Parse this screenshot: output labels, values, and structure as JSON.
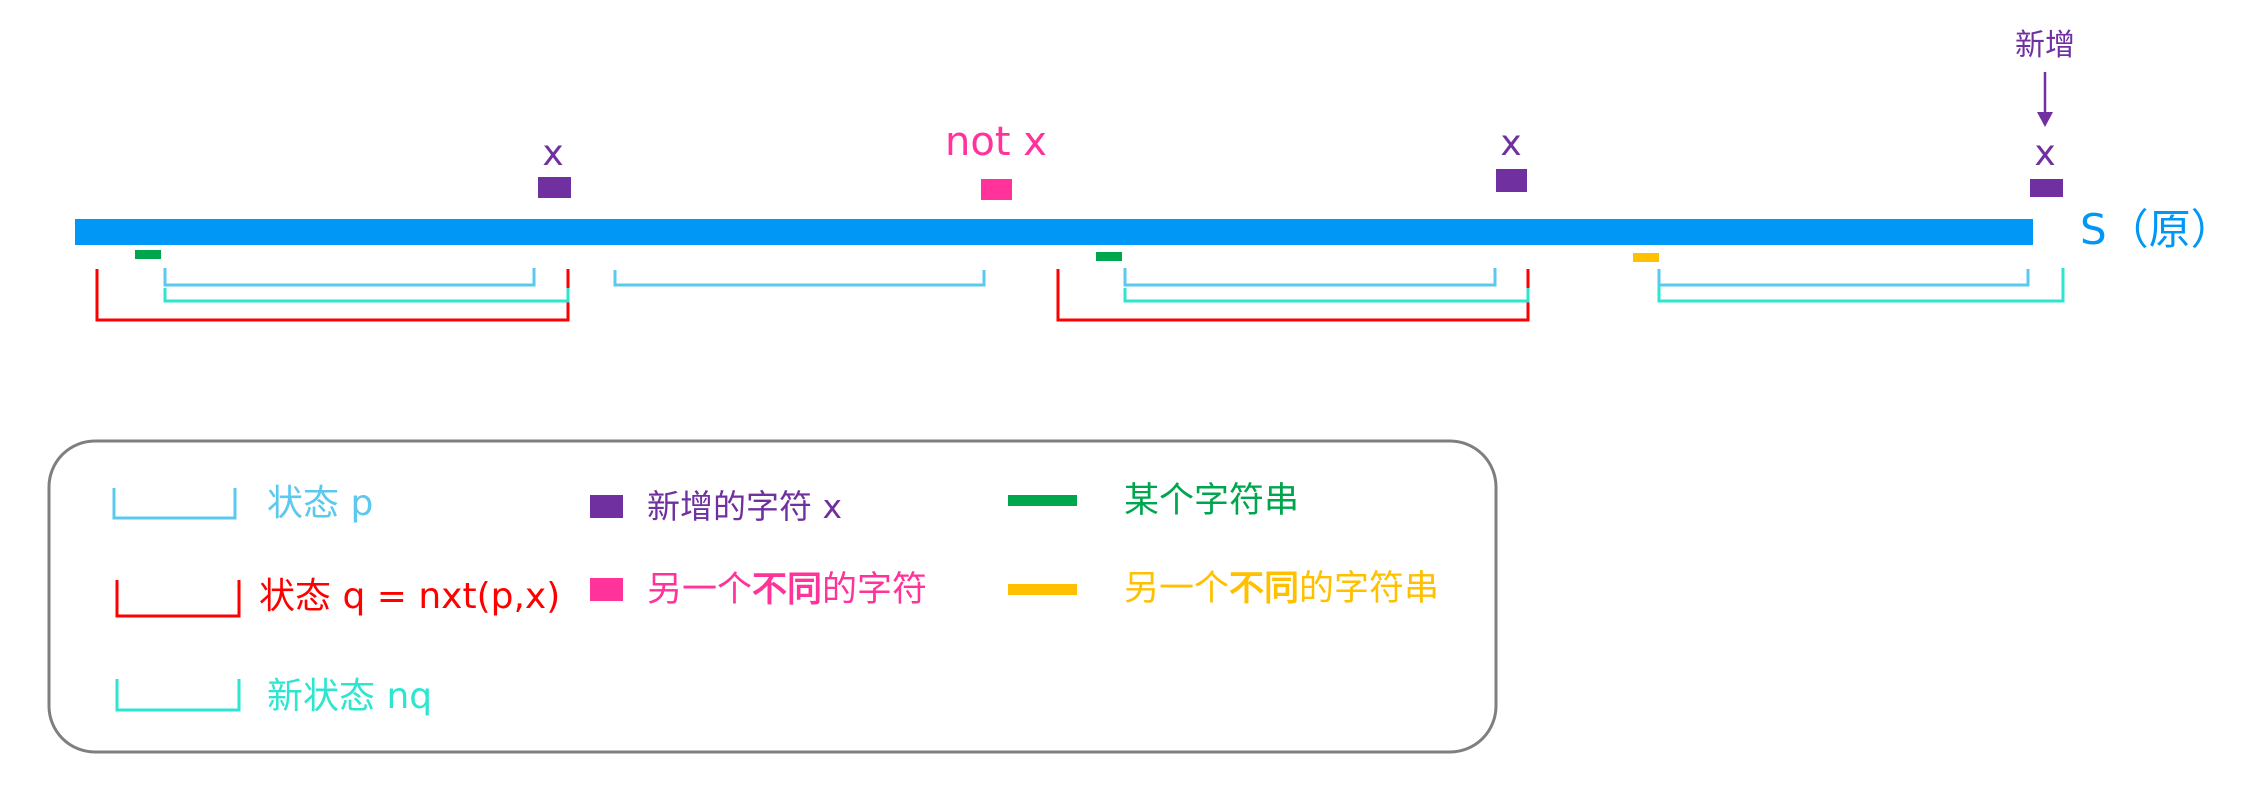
{
  "colors": {
    "string_bar": "#0097F7",
    "added_char": "#7030A0",
    "different_char": "#FF339A",
    "some_string": "#00A64E",
    "other_string": "#FFC000",
    "state_p": "#5BC8F0",
    "state_q": "#FF0000",
    "new_state": "#2EE6D0",
    "legend_border": "#7F7F7F"
  },
  "diagram": {
    "string_label": "S（原）",
    "char_x": "x",
    "char_not_x": "not x",
    "added_note": "新增"
  },
  "legend": {
    "state_p": "状态 p",
    "state_q": "状态 q = nxt(p,x)",
    "new_state": "新状态 nq",
    "added_char": "新增的字符 x",
    "different_char_prefix": "另一个",
    "different_char_bold": "不同",
    "different_char_suffix": "的字符",
    "some_string": "某个字符串",
    "other_string_prefix": "另一个",
    "other_string_bold": "不同",
    "other_string_suffix": "的字符串"
  }
}
